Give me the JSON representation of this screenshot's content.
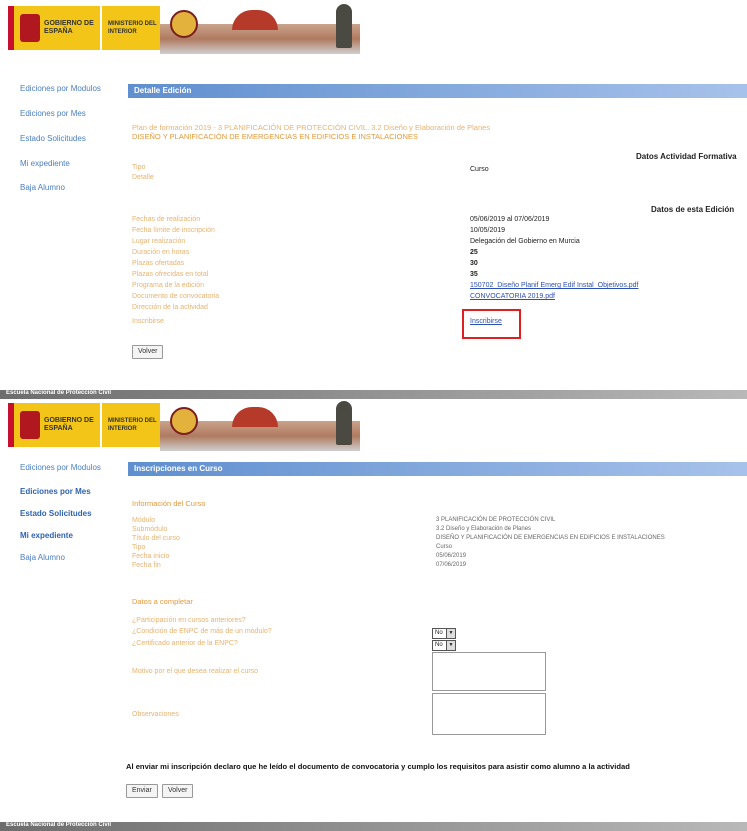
{
  "header": {
    "gobierno": "GOBIERNO DE ESPAÑA",
    "ministerio": "MINISTERIO DEL INTERIOR"
  },
  "sidebar": {
    "items": [
      "Ediciones por Modulos",
      "Ediciones por Mes",
      "Estado Solicitudes",
      "Mi expediente",
      "Baja Alumno"
    ]
  },
  "top": {
    "bar_title": "Detalle Edición",
    "course_line1": "Plan de formación 2019 - 3 PLANIFICACIÓN DE PROTECCIÓN CIVIL. 3.2 Diseño y Elaboración de Planes",
    "course_line2": "DISEÑO Y PLANIFICACIÓN DE EMERGENCIAS EN EDIFICIOS E INSTALACIONES",
    "datos_actividad": "Datos Actividad Formativa",
    "tipo_label": "Tipo",
    "tipo_value": "Curso",
    "detalle_label": "Detalle",
    "datos_edicion": "Datos de esta Edición",
    "fields": [
      {
        "label": "Fechas de realización",
        "value": "05/06/2019 al 07/06/2019",
        "link": false
      },
      {
        "label": "Fecha límite de inscripción",
        "value": "10/05/2019",
        "link": false
      },
      {
        "label": "Lugar realización",
        "value": "Delegación del Gobierno en Murcia",
        "link": false
      },
      {
        "label": "Duración en horas",
        "value": "25",
        "link": false
      },
      {
        "label": "Plazas ofertadas",
        "value": "30",
        "link": false
      },
      {
        "label": "Plazas ofrecidas en total",
        "value": "35",
        "link": false
      },
      {
        "label": "Programa de la edición",
        "value": "150702_Diseño Planif Emerg Edif Instal_Objetivos.pdf",
        "link": true
      },
      {
        "label": "Documento de convocatoria",
        "value": "CONVOCATORIA 2019.pdf",
        "link": true
      },
      {
        "label": "Dirección de la actividad",
        "value": "",
        "link": false
      },
      {
        "label": "Inscribirse",
        "value": "Inscribirse",
        "link": true
      }
    ],
    "volver": "Volver"
  },
  "window_bar_1": "Escuela Nacional de Protección Civil",
  "bottom": {
    "bar_title": "Inscripciones en Curso",
    "info_title": "Información del Curso",
    "info_fields": [
      {
        "label": "Módulo",
        "value": "3 PLANIFICACIÓN DE PROTECCIÓN CIVIL"
      },
      {
        "label": "Submódulo",
        "value": "3.2 Diseño y Elaboración de Planes"
      },
      {
        "label": "Título del curso",
        "value": "DISEÑO Y PLANIFICACIÓN DE EMERGENCIAS EN EDIFICIOS E INSTALACIONES"
      },
      {
        "label": "Tipo",
        "value": "Curso"
      },
      {
        "label": "Fecha inicio",
        "value": "05/06/2019"
      },
      {
        "label": "Fecha fin",
        "value": "07/06/2019"
      }
    ],
    "datos_title": "Datos a completar",
    "questions": [
      "¿Participación en cursos anteriores?",
      "¿Condición de ENPC de más de un módulo?",
      "¿Certificado anterior de la ENPC?"
    ],
    "select_value": "No",
    "motivo_label": "Motivo por el que desea realizar el curso",
    "observaciones_label": "Observaciones",
    "declaration": "Al enviar mi inscripción declaro que he leído el documento de convocatoria y cumplo los requisitos para asistir como alumno a la actividad",
    "enviar": "Enviar",
    "volver": "Volver"
  },
  "window_bar_2": "Escuela Nacional de Protección Civil"
}
